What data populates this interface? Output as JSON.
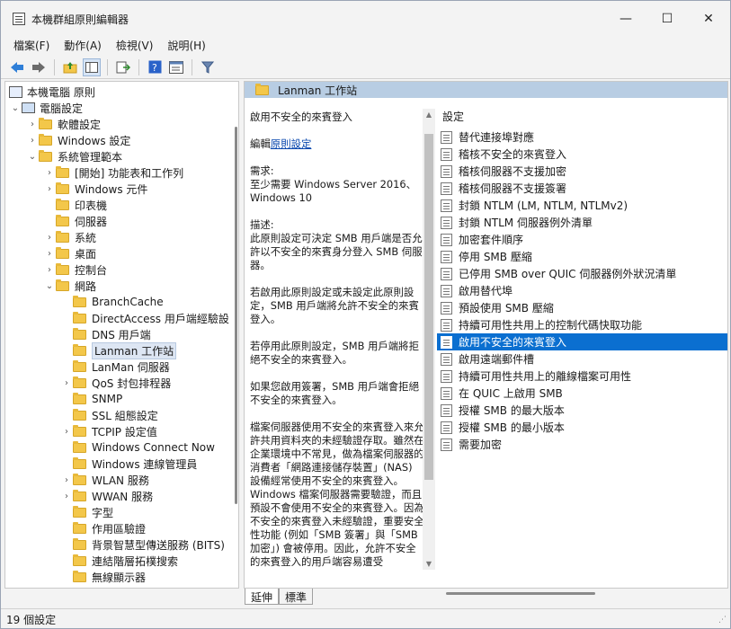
{
  "window": {
    "title": "本機群組原則編輯器",
    "min": "—",
    "max": "☐",
    "close": "✕"
  },
  "menu": [
    "檔案(F)",
    "動作(A)",
    "檢視(V)",
    "說明(H)"
  ],
  "toolbar_icons": [
    "back-arrow-icon",
    "forward-arrow-icon",
    "up-folder-icon",
    "show-hide-tree-icon",
    "export-list-icon",
    "help-icon",
    "properties-icon",
    "filter-icon"
  ],
  "tree": {
    "root": "本機電腦 原則",
    "computer_config": "電腦設定",
    "items": [
      {
        "label": "軟體設定",
        "twisty": "›"
      },
      {
        "label": "Windows 設定",
        "twisty": "›"
      },
      {
        "label": "系統管理範本",
        "twisty": "⌄"
      },
      {
        "label": "[開始] 功能表和工作列",
        "twisty": "›"
      },
      {
        "label": "Windows 元件",
        "twisty": "›"
      },
      {
        "label": "印表機",
        "twisty": ""
      },
      {
        "label": "伺服器",
        "twisty": ""
      },
      {
        "label": "系統",
        "twisty": "›"
      },
      {
        "label": "桌面",
        "twisty": "›"
      },
      {
        "label": "控制台",
        "twisty": "›"
      },
      {
        "label": "網路",
        "twisty": "⌄"
      },
      {
        "label": "BranchCache",
        "twisty": ""
      },
      {
        "label": "DirectAccess 用戶端經驗設",
        "twisty": ""
      },
      {
        "label": "DNS 用戶端",
        "twisty": ""
      },
      {
        "label": "Lanman 工作站",
        "twisty": ""
      },
      {
        "label": "LanMan 伺服器",
        "twisty": ""
      },
      {
        "label": "QoS 封包排程器",
        "twisty": "›"
      },
      {
        "label": "SNMP",
        "twisty": ""
      },
      {
        "label": "SSL 組態設定",
        "twisty": ""
      },
      {
        "label": "TCPIP 設定值",
        "twisty": "›"
      },
      {
        "label": "Windows Connect Now",
        "twisty": ""
      },
      {
        "label": "Windows 連線管理員",
        "twisty": ""
      },
      {
        "label": "WLAN 服務",
        "twisty": "›"
      },
      {
        "label": "WWAN 服務",
        "twisty": "›"
      },
      {
        "label": "字型",
        "twisty": ""
      },
      {
        "label": "作用區驗證",
        "twisty": ""
      },
      {
        "label": "背景智慧型傳送服務 (BITS)",
        "twisty": ""
      },
      {
        "label": "連結階層拓樸搜索",
        "twisty": ""
      },
      {
        "label": "無線顯示器",
        "twisty": ""
      }
    ]
  },
  "right": {
    "header": "Lanman 工作站",
    "desc_title": "啟用不安全的來賓登入",
    "edit_prefix": "編輯",
    "edit_link": "原則設定",
    "paragraphs": [
      "需求:\n至少需要 Windows Server 2016、Windows 10",
      "描述:\n此原則設定可決定 SMB 用戶端是否允許以不安全的來賓身分登入 SMB 伺服器。",
      "若啟用此原則設定或未設定此原則設定，SMB 用戶端將允許不安全的來賓登入。",
      "若停用此原則設定，SMB 用戶端將拒絕不安全的來賓登入。",
      "如果您啟用簽署，SMB 用戶端會拒絕不安全的來賓登入。",
      "檔案伺服器使用不安全的來賓登入來允許共用資料夾的未經驗證存取。雖然在企業環境中不常見，做為檔案伺服器的消費者「網路連接儲存裝置」(NAS) 設備經常使用不安全的來賓登入。Windows 檔案伺服器需要驗證，而且預設不會使用不安全的來賓登入。因為不安全的來賓登入未經驗證，重要安全性功能 (例如「SMB 簽署」與「SMB 加密」) 會被停用。因此，允許不安全的來賓登入的用戶端容易遭受"
    ],
    "list_header": "設定",
    "settings": [
      "替代連接埠對應",
      "稽核不安全的來賓登入",
      "稽核伺服器不支援加密",
      "稽核伺服器不支援簽署",
      "封鎖 NTLM (LM, NTLM, NTLMv2)",
      "封鎖 NTLM 伺服器例外清單",
      "加密套件順序",
      "停用 SMB 壓縮",
      "已停用 SMB over QUIC 伺服器例外狀況清單",
      "啟用替代埠",
      "預設使用 SMB 壓縮",
      "持續可用性共用上的控制代碼快取功能",
      "啟用不安全的來賓登入",
      "啟用遠端郵件槽",
      "持續可用性共用上的離線檔案可用性",
      "在 QUIC 上啟用 SMB",
      "授權 SMB 的最大版本",
      "授權 SMB 的最小版本",
      "需要加密"
    ],
    "selected_setting": "啟用不安全的來賓登入"
  },
  "tabs": [
    "延伸",
    "標準"
  ],
  "status": "19 個設定"
}
